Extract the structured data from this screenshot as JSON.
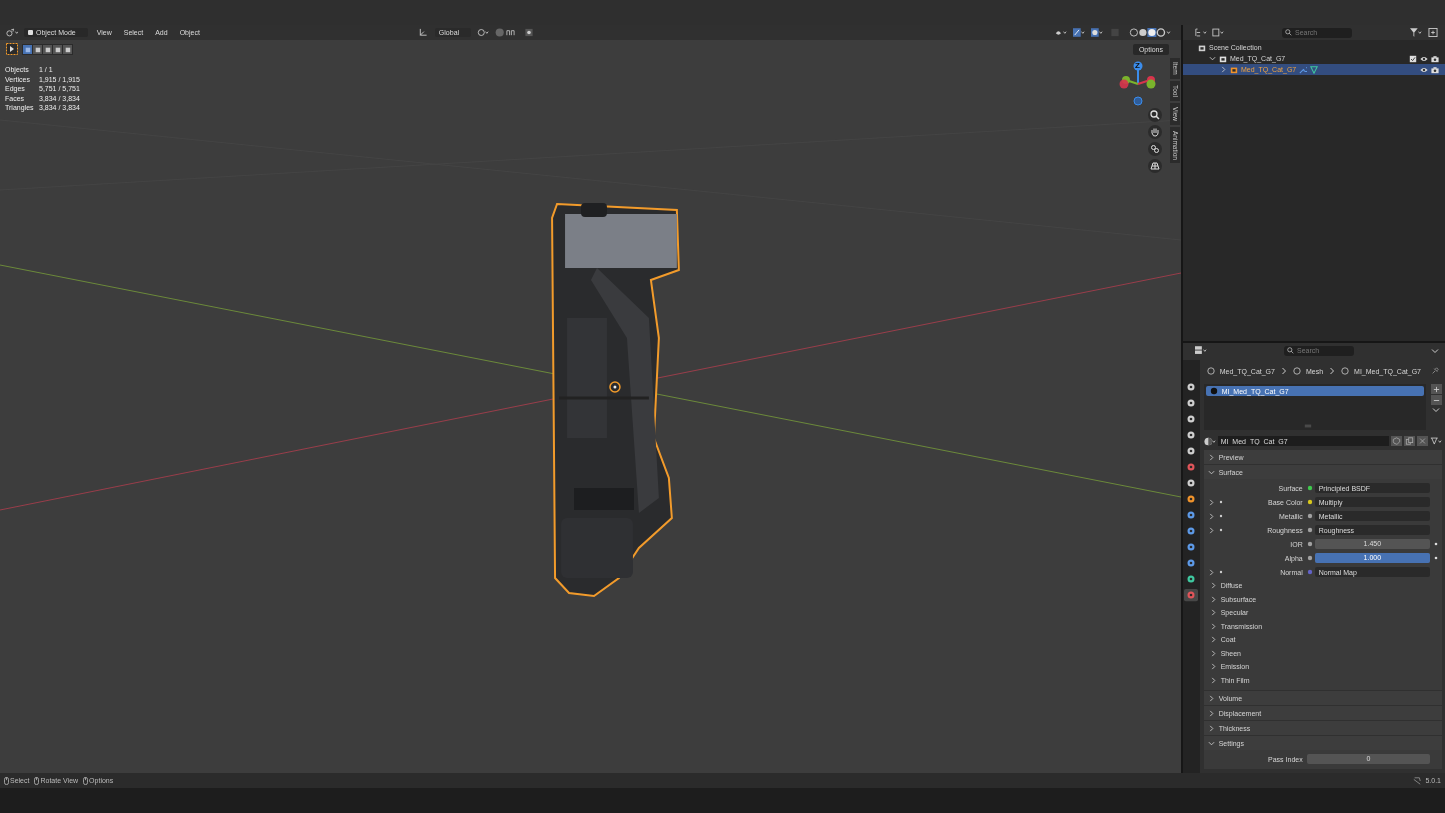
{
  "viewport": {
    "header": {
      "mode": "Object Mode",
      "menus": [
        "View",
        "Select",
        "Add",
        "Object"
      ],
      "orientation": "Global"
    },
    "options": "Options",
    "select_modes": [
      {
        "selected": true
      },
      {
        "selected": false
      },
      {
        "selected": false
      },
      {
        "selected": false
      },
      {
        "selected": false
      }
    ],
    "stats": [
      {
        "label": "Objects",
        "value": "1 / 1"
      },
      {
        "label": "Vertices",
        "value": "1,915 / 1,915"
      },
      {
        "label": "Edges",
        "value": "5,751 / 5,751"
      },
      {
        "label": "Faces",
        "value": "3,834 / 3,834"
      },
      {
        "label": "Triangles",
        "value": "3,834 / 3,834"
      }
    ],
    "gizmo_label": "Z",
    "side_tabs": [
      "Item",
      "Tool",
      "View",
      "Animation"
    ]
  },
  "outliner": {
    "search": {
      "placeholder": "Search"
    },
    "tree": [
      {
        "label": "Scene Collection",
        "kind": "scene",
        "selected": false,
        "children": [
          {
            "label": "Med_TQ_Cat_G7",
            "kind": "collection",
            "expanded": true,
            "selected": false,
            "children": [
              {
                "label": "Med_TQ_Cat_G7",
                "kind": "object",
                "expanded": false,
                "selected": true
              }
            ]
          }
        ]
      }
    ]
  },
  "properties": {
    "search": {
      "placeholder": "Search"
    },
    "tabs": [
      {
        "kind": "tool",
        "selected": false
      },
      {
        "kind": "render",
        "selected": false
      },
      {
        "kind": "output",
        "selected": false
      },
      {
        "kind": "view-layer",
        "selected": false
      },
      {
        "kind": "scene",
        "selected": false
      },
      {
        "kind": "world",
        "selected": false
      },
      {
        "kind": "collection",
        "selected": false
      },
      {
        "kind": "object",
        "selected": false
      },
      {
        "kind": "modifiers",
        "selected": false
      },
      {
        "kind": "particles",
        "selected": false
      },
      {
        "kind": "physics",
        "selected": false
      },
      {
        "kind": "constraints",
        "selected": false
      },
      {
        "kind": "data",
        "selected": false
      },
      {
        "kind": "material",
        "selected": true
      }
    ],
    "breadcrumb": [
      "Med_TQ_Cat_G7",
      "Mesh",
      "MI_Med_TQ_Cat_G7"
    ],
    "slots": [
      {
        "label": "MI_Med_TQ_Cat_G7",
        "selected": true
      }
    ],
    "material_name": "MI_Med_TQ_Cat_G7",
    "sections": [
      {
        "label": "Preview",
        "expanded": false
      },
      {
        "label": "Surface",
        "expanded": true,
        "rows": [
          {
            "label": "Surface",
            "kind": "link",
            "value": "Principled BSDF",
            "color": "#3fc94d"
          },
          {
            "label": "Base Color",
            "kind": "link",
            "value": "Multiply",
            "color": "#d8c81c",
            "expandable": true
          },
          {
            "label": "Metallic",
            "kind": "link",
            "value": "Metallic",
            "color": "#a1a1a1",
            "expandable": true
          },
          {
            "label": "Roughness",
            "kind": "link",
            "value": "Roughness",
            "color": "#a1a1a1",
            "expandable": true
          },
          {
            "label": "IOR",
            "kind": "number",
            "value": "1.450",
            "color": "#a1a1a1",
            "keyframe": true
          },
          {
            "label": "Alpha",
            "kind": "slider",
            "value": "1.000",
            "level": 1,
            "color": "#a1a1a1",
            "keyframe": true
          },
          {
            "label": "Normal",
            "kind": "link",
            "value": "Normal Map",
            "color": "#6363c7",
            "expandable": true
          }
        ],
        "subpanels": [
          "Diffuse",
          "Subsurface",
          "Specular",
          "Transmission",
          "Coat",
          "Sheen",
          "Emission",
          "Thin Film"
        ]
      },
      {
        "label": "Volume",
        "expanded": false
      },
      {
        "label": "Displacement",
        "expanded": false
      },
      {
        "label": "Thickness",
        "expanded": false
      },
      {
        "label": "Settings",
        "expanded": true,
        "rows": [
          {
            "label": "Pass Index",
            "kind": "number",
            "value": "0"
          }
        ]
      }
    ]
  },
  "status_bar": {
    "hints": [
      "Select",
      "Rotate View",
      "Options"
    ],
    "version": "5.0.1"
  }
}
